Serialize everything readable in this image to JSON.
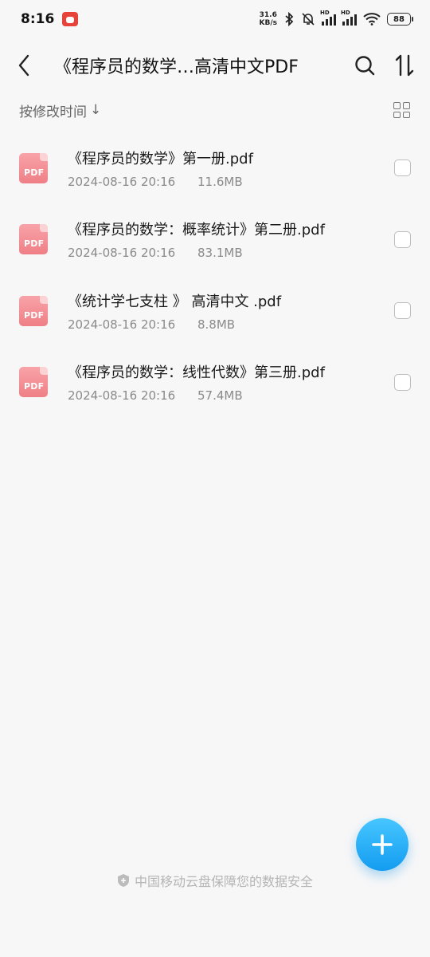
{
  "status_bar": {
    "time": "8:16",
    "net_speed_value": "31.6",
    "net_speed_unit": "KB/s",
    "hd1": "HD",
    "hd2": "HD",
    "battery": "88"
  },
  "header": {
    "title": "《程序员的数学…高清中文PDF"
  },
  "sort_bar": {
    "label": "按修改时间",
    "arrow": "↓"
  },
  "files": [
    {
      "name": "《程序员的数学》第一册.pdf",
      "date": "2024-08-16 20:16",
      "size": "11.6MB",
      "icon_label": "PDF"
    },
    {
      "name": "《程序员的数学：概率统计》第二册.pdf",
      "date": "2024-08-16 20:16",
      "size": "83.1MB",
      "icon_label": "PDF"
    },
    {
      "name": "《统计学七支柱 》 高清中文 .pdf",
      "date": "2024-08-16 20:16",
      "size": "8.8MB",
      "icon_label": "PDF"
    },
    {
      "name": "《程序员的数学：线性代数》第三册.pdf",
      "date": "2024-08-16 20:16",
      "size": "57.4MB",
      "icon_label": "PDF"
    }
  ],
  "footer": {
    "text": "中国移动云盘保障您的数据安全"
  },
  "colors": {
    "accent": "#139cf0",
    "pdf_icon": "#ef7f86",
    "background": "#f7f7f8"
  },
  "icons": {
    "back": "back-arrow-icon",
    "search": "search-icon",
    "sort": "sort-icon",
    "grid": "grid-view-icon",
    "fab": "plus-icon",
    "footer": "shield-icon"
  }
}
